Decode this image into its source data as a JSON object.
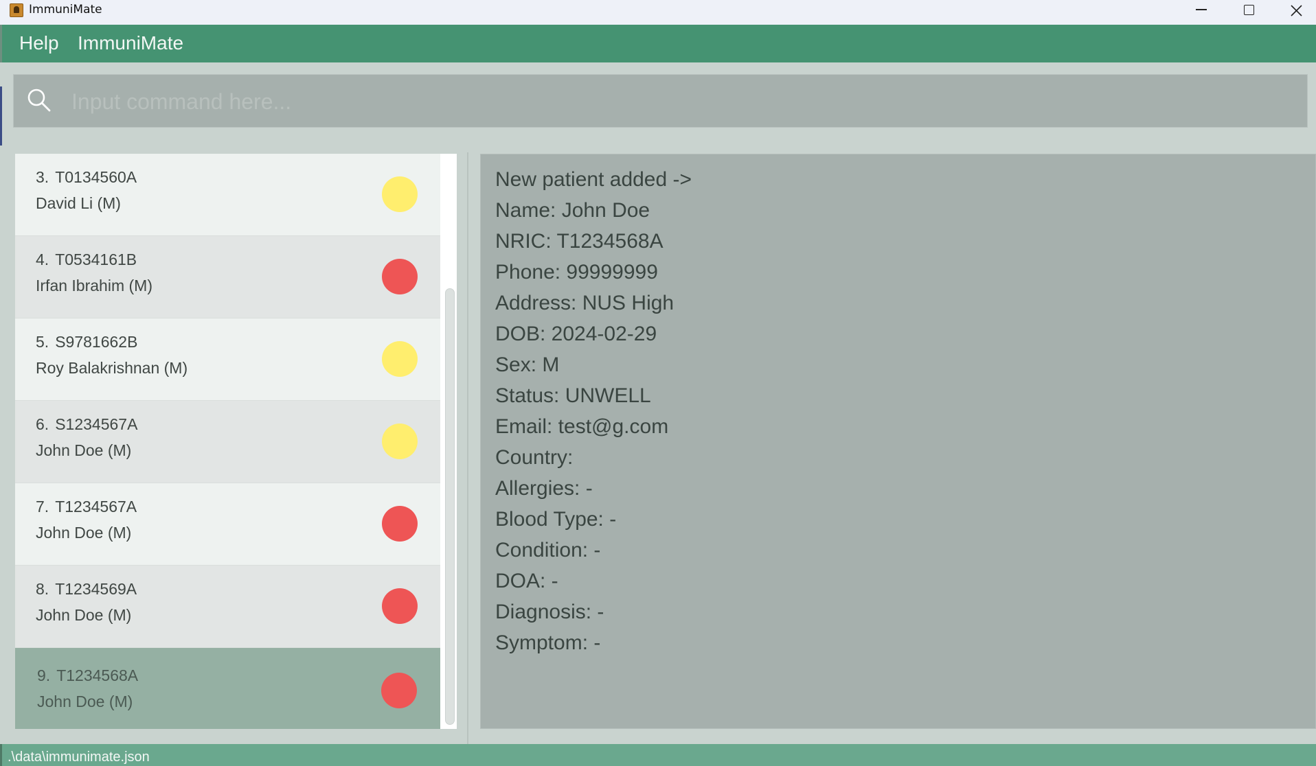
{
  "window": {
    "title": "ImmuniMate",
    "icon": "contact-book-icon"
  },
  "menu": {
    "items": [
      "Help",
      "ImmuniMate"
    ]
  },
  "command": {
    "placeholder": "Input command here...",
    "value": "",
    "icon": "search-icon"
  },
  "colors": {
    "accent": "#459372",
    "status_bar": "#6aa88e",
    "selected_card": "#95b0a3",
    "status_red": "#ee5555",
    "status_yellow": "#ffee6e"
  },
  "patients": [
    {
      "index": "3.",
      "nric": "T0134560A",
      "name": "David Li (M)",
      "status_color": "yellow"
    },
    {
      "index": "4.",
      "nric": "T0534161B",
      "name": "Irfan Ibrahim (M)",
      "status_color": "red"
    },
    {
      "index": "5.",
      "nric": "S9781662B",
      "name": "Roy Balakrishnan (M)",
      "status_color": "yellow"
    },
    {
      "index": "6.",
      "nric": "S1234567A",
      "name": "John Doe (M)",
      "status_color": "yellow"
    },
    {
      "index": "7.",
      "nric": "T1234567A",
      "name": "John Doe (M)",
      "status_color": "red"
    },
    {
      "index": "8.",
      "nric": "T1234569A",
      "name": "John Doe (M)",
      "status_color": "red"
    },
    {
      "index": "9.",
      "nric": "T1234568A",
      "name": "John Doe (M)",
      "status_color": "red",
      "selected": true
    }
  ],
  "result": {
    "lines": [
      "New patient added ->",
      "Name: John Doe",
      "NRIC: T1234568A",
      "Phone: 99999999",
      "Address: NUS High",
      "DOB: 2024-02-29",
      "Sex: M",
      "Status: UNWELL",
      "Email: test@g.com",
      "Country:",
      "Allergies: -",
      "Blood Type: -",
      "Condition: -",
      "DOA: -",
      "Diagnosis: -",
      "Symptom: -"
    ]
  },
  "status_bar": {
    "path": ".\\data\\immunimate.json"
  }
}
